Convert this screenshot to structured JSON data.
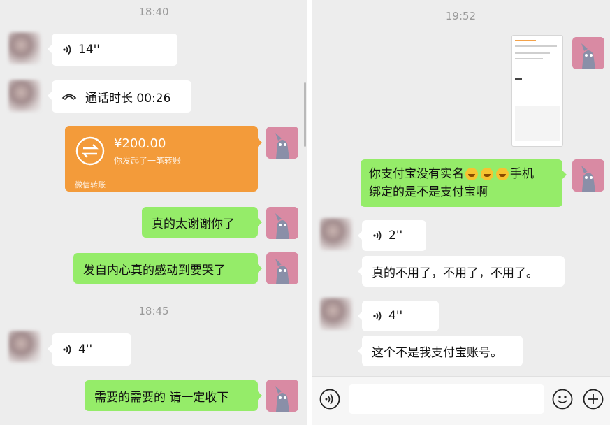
{
  "left": {
    "time_1": "18:40",
    "voice_1": "14''",
    "call_duration": "通话时长 00:26",
    "transfer": {
      "amount": "¥200.00",
      "desc": "你发起了一笔转账",
      "footer": "微信转账"
    },
    "msg_thanks": "真的太谢谢你了",
    "msg_moved": "发自内心真的感动到要哭了",
    "time_2": "18:45",
    "voice_2": "4''",
    "msg_accept": "需要的需要的 请一定收下"
  },
  "right": {
    "time_1": "19:52",
    "msg_alipay": "你支付宝没有实名",
    "msg_alipay_cont": "手机",
    "msg_alipay_line2": "绑定的是不是支付宝啊",
    "voice_1": "2''",
    "msg_refuse": "真的不用了，不用了，不用了。",
    "voice_2": "4''",
    "msg_not_mine": "这个不是我支付宝账号。"
  },
  "input_bar": {
    "value": ""
  },
  "colors": {
    "background": "#ededed",
    "green_bubble": "#95ec69",
    "transfer_orange": "#f39b3a"
  },
  "icons": [
    "voice-icon",
    "phone-call-icon",
    "transfer-icon",
    "emoji-laugh-icon",
    "voice-input-icon",
    "emoji-icon",
    "plus-icon"
  ]
}
